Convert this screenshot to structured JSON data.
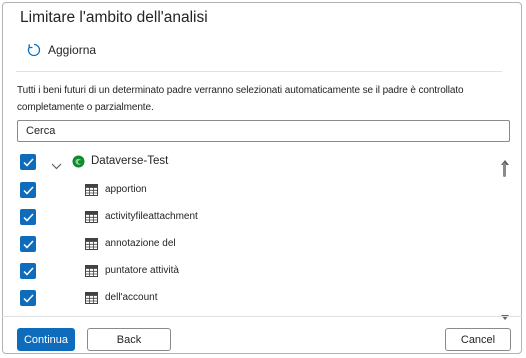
{
  "dialog": {
    "title": "Limitare l'ambito dell'analisi",
    "refresh_label": "Aggiorna",
    "description": "Tutti i beni futuri di un determinato padre verranno selezionati automaticamente se il padre è controllato completamente o parzialmente.",
    "search": {
      "value": "Cerca",
      "placeholder": "Cerca"
    }
  },
  "tree": {
    "root": {
      "label": "Dataverse-Test",
      "checked": true,
      "expanded": true
    },
    "items": [
      {
        "label": "apportion",
        "checked": true
      },
      {
        "label": "activityfileattachment",
        "checked": true
      },
      {
        "label": "annotazione del",
        "checked": true
      },
      {
        "label": "puntatore attività",
        "checked": true
      },
      {
        "label": "dell'account",
        "checked": true
      }
    ]
  },
  "footer": {
    "continue_label": "Continua",
    "back_label": "Back",
    "cancel_label": "Cancel"
  },
  "colors": {
    "accent": "#0f6cbd",
    "text": "#242424",
    "border": "#8a8a8a"
  },
  "icons": {
    "refresh": "refresh-icon",
    "checkbox": "checkmark-icon",
    "chevron": "chevron-down-icon",
    "dataverse": "dataverse-logo-icon",
    "table": "table-icon"
  }
}
